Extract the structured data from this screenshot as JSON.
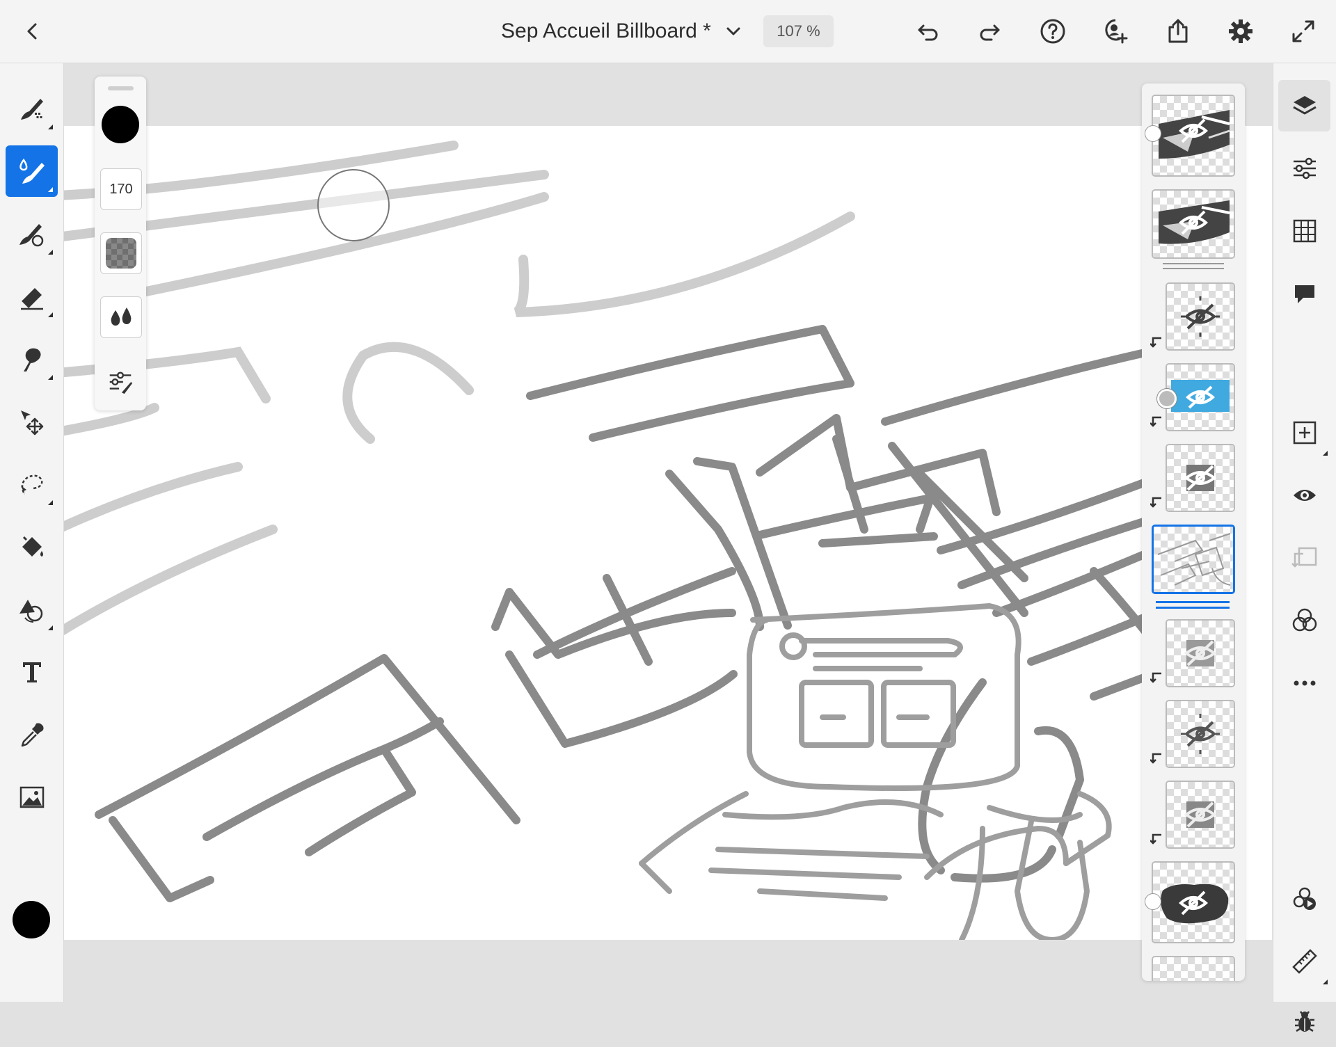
{
  "topbar": {
    "document_title": "Sep Accueil Billboard *",
    "zoom": "107 %",
    "icons": [
      "back-icon",
      "chevron-down-icon",
      "undo-icon",
      "redo-icon",
      "help-icon",
      "invite-icon",
      "share-icon",
      "settings-icon",
      "fullscreen-icon"
    ]
  },
  "left_toolbar": {
    "tools": [
      "pixel-brush",
      "vector-brush",
      "mixer-brush",
      "eraser",
      "smudge",
      "transform",
      "selection",
      "fill",
      "shapes",
      "type",
      "eyedropper",
      "place-image"
    ],
    "active_tool": "vector-brush",
    "current_color": "#000000"
  },
  "brush_properties": {
    "color": "#000000",
    "size": "170"
  },
  "layers": {
    "count_visible": 11,
    "selected_index": 5
  },
  "right_toolbar": {
    "tools": [
      "layers",
      "layer-properties",
      "grid",
      "comments",
      "add-layer",
      "visibility",
      "clipping-mask",
      "blend-modes",
      "more",
      "livestream",
      "ruler",
      "debug"
    ],
    "active_tool": "layers"
  },
  "colors": {
    "accent": "#1473e6",
    "highlight_layer": "#3fa9e0"
  }
}
